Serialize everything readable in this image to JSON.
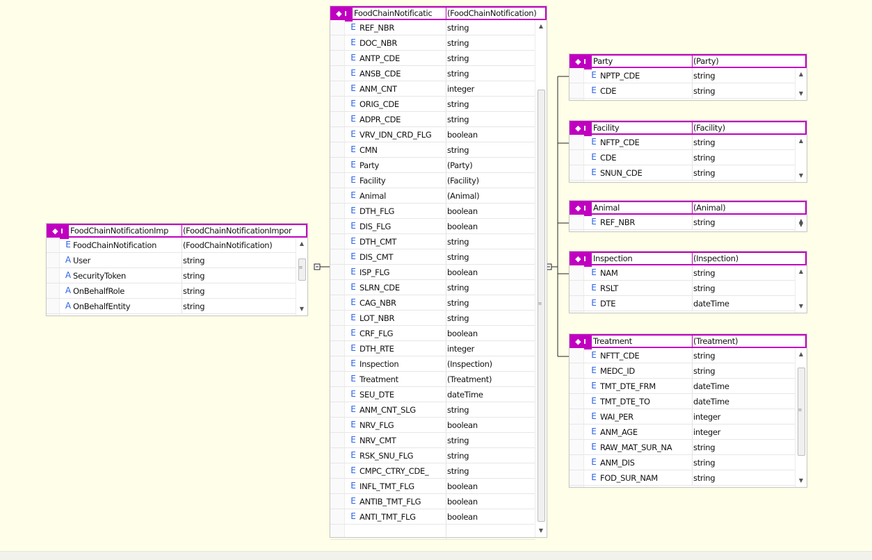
{
  "icons": {
    "element_icon": "E",
    "attribute_icon": "A",
    "header_icon": "◆ I"
  },
  "colors": {
    "header_accent": "#c000c0",
    "element_icon": "#2b63e6",
    "canvas": "#fffee8"
  },
  "import": {
    "header": {
      "name": "FoodChainNotificationImp",
      "type": "(FoodChainNotificationImpor"
    },
    "rows": [
      {
        "kind": "E",
        "name": "FoodChainNotification",
        "type": "(FoodChainNotification)"
      },
      {
        "kind": "A",
        "name": "User",
        "type": "string"
      },
      {
        "kind": "A",
        "name": "SecurityToken",
        "type": "string"
      },
      {
        "kind": "A",
        "name": "OnBehalfRole",
        "type": "string"
      },
      {
        "kind": "A",
        "name": "OnBehalfEntity",
        "type": "string"
      }
    ]
  },
  "main": {
    "header": {
      "name": "FoodChainNotificatic",
      "type": "(FoodChainNotification)"
    },
    "rows": [
      {
        "kind": "E",
        "name": "REF_NBR",
        "type": "string"
      },
      {
        "kind": "E",
        "name": "DOC_NBR",
        "type": "string"
      },
      {
        "kind": "E",
        "name": "ANTP_CDE",
        "type": "string"
      },
      {
        "kind": "E",
        "name": "ANSB_CDE",
        "type": "string"
      },
      {
        "kind": "E",
        "name": "ANM_CNT",
        "type": "integer"
      },
      {
        "kind": "E",
        "name": "ORIG_CDE",
        "type": "string"
      },
      {
        "kind": "E",
        "name": "ADPR_CDE",
        "type": "string"
      },
      {
        "kind": "E",
        "name": "VRV_IDN_CRD_FLG",
        "type": "boolean"
      },
      {
        "kind": "E",
        "name": "CMN",
        "type": "string"
      },
      {
        "kind": "E",
        "name": "Party",
        "type": "(Party)"
      },
      {
        "kind": "E",
        "name": "Facility",
        "type": "(Facility)"
      },
      {
        "kind": "E",
        "name": "Animal",
        "type": "(Animal)"
      },
      {
        "kind": "E",
        "name": "DTH_FLG",
        "type": "boolean"
      },
      {
        "kind": "E",
        "name": "DIS_FLG",
        "type": "boolean"
      },
      {
        "kind": "E",
        "name": "DTH_CMT",
        "type": "string"
      },
      {
        "kind": "E",
        "name": "DIS_CMT",
        "type": "string"
      },
      {
        "kind": "E",
        "name": "ISP_FLG",
        "type": "boolean"
      },
      {
        "kind": "E",
        "name": "SLRN_CDE",
        "type": "string"
      },
      {
        "kind": "E",
        "name": "CAG_NBR",
        "type": "string"
      },
      {
        "kind": "E",
        "name": "LOT_NBR",
        "type": "string"
      },
      {
        "kind": "E",
        "name": "CRF_FLG",
        "type": "boolean"
      },
      {
        "kind": "E",
        "name": "DTH_RTE",
        "type": "integer"
      },
      {
        "kind": "E",
        "name": "Inspection",
        "type": "(Inspection)"
      },
      {
        "kind": "E",
        "name": "Treatment",
        "type": "(Treatment)"
      },
      {
        "kind": "E",
        "name": "SEU_DTE",
        "type": "dateTime"
      },
      {
        "kind": "E",
        "name": "ANM_CNT_SLG",
        "type": "string"
      },
      {
        "kind": "E",
        "name": "NRV_FLG",
        "type": "boolean"
      },
      {
        "kind": "E",
        "name": "NRV_CMT",
        "type": "string"
      },
      {
        "kind": "E",
        "name": "RSK_SNU_FLG",
        "type": "string"
      },
      {
        "kind": "E",
        "name": "CMPC_CTRY_CDE_",
        "type": "string"
      },
      {
        "kind": "E",
        "name": "INFL_TMT_FLG",
        "type": "boolean"
      },
      {
        "kind": "E",
        "name": "ANTIB_TMT_FLG",
        "type": "boolean"
      },
      {
        "kind": "E",
        "name": "ANTI_TMT_FLG",
        "type": "boolean"
      },
      {
        "kind": "",
        "name": "",
        "type": ""
      }
    ]
  },
  "children": [
    {
      "id": "party",
      "header": {
        "name": "Party",
        "type": "(Party)"
      },
      "rows": [
        {
          "kind": "E",
          "name": "NPTP_CDE",
          "type": "string"
        },
        {
          "kind": "E",
          "name": "CDE",
          "type": "string"
        }
      ]
    },
    {
      "id": "facility",
      "header": {
        "name": "Facility",
        "type": "(Facility)"
      },
      "rows": [
        {
          "kind": "E",
          "name": "NFTP_CDE",
          "type": "string"
        },
        {
          "kind": "E",
          "name": "CDE",
          "type": "string"
        },
        {
          "kind": "E",
          "name": "SNUN_CDE",
          "type": "string"
        }
      ]
    },
    {
      "id": "animal",
      "header": {
        "name": "Animal",
        "type": "(Animal)"
      },
      "rows": [
        {
          "kind": "E",
          "name": "REF_NBR",
          "type": "string"
        }
      ]
    },
    {
      "id": "inspection",
      "header": {
        "name": "Inspection",
        "type": "(Inspection)"
      },
      "rows": [
        {
          "kind": "E",
          "name": "NAM",
          "type": "string"
        },
        {
          "kind": "E",
          "name": "RSLT",
          "type": "string"
        },
        {
          "kind": "E",
          "name": "DTE",
          "type": "dateTime"
        }
      ]
    },
    {
      "id": "treatment",
      "header": {
        "name": "Treatment",
        "type": "(Treatment)"
      },
      "rows": [
        {
          "kind": "E",
          "name": "NFTT_CDE",
          "type": "string"
        },
        {
          "kind": "E",
          "name": "MEDC_ID",
          "type": "string"
        },
        {
          "kind": "E",
          "name": "TMT_DTE_FRM",
          "type": "dateTime"
        },
        {
          "kind": "E",
          "name": "TMT_DTE_TO",
          "type": "dateTime"
        },
        {
          "kind": "E",
          "name": "WAI_PER",
          "type": "integer"
        },
        {
          "kind": "E",
          "name": "ANM_AGE",
          "type": "integer"
        },
        {
          "kind": "E",
          "name": "RAW_MAT_SUR_NA",
          "type": "string"
        },
        {
          "kind": "E",
          "name": "ANM_DIS",
          "type": "string"
        },
        {
          "kind": "E",
          "name": "FOD_SUR_NAM",
          "type": "string"
        }
      ]
    }
  ]
}
